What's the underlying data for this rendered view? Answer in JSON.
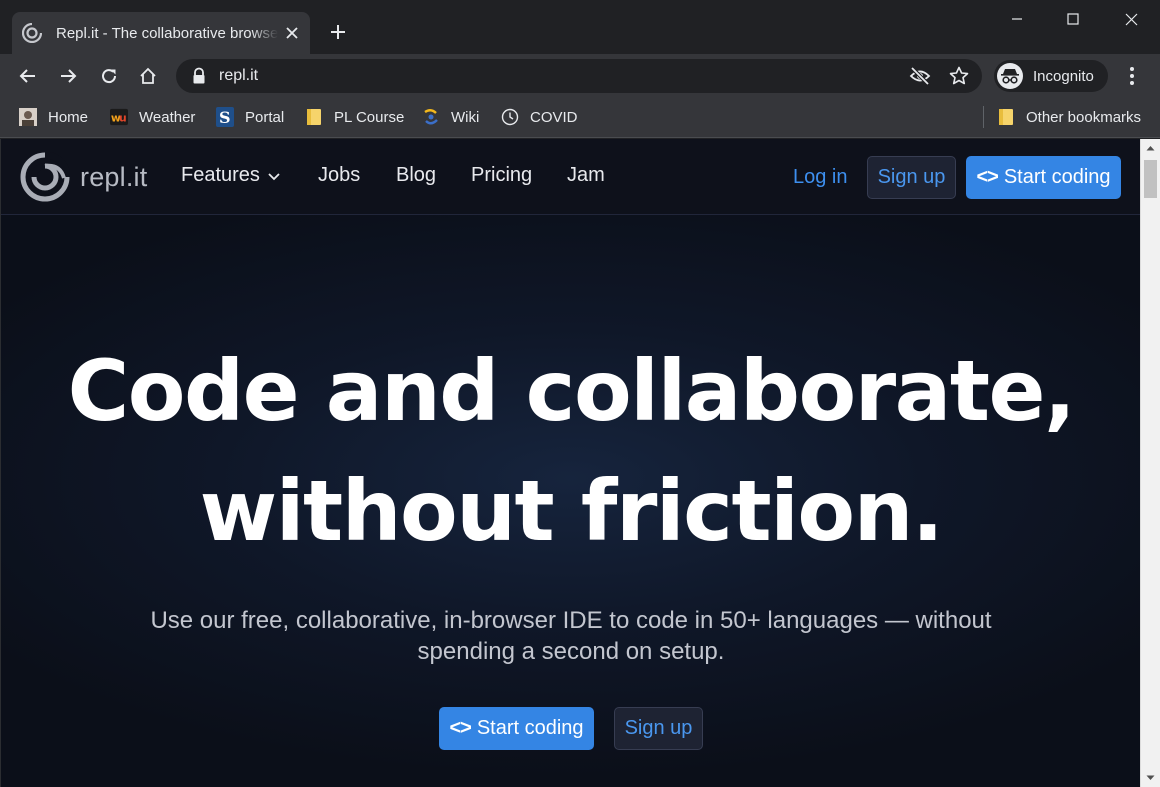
{
  "browser": {
    "tab_title": "Repl.it - The collaborative browser based IDE",
    "url": "repl.it",
    "profile_label": "Incognito",
    "bookmarks": [
      {
        "label": "Home",
        "icon": "avatar-icon"
      },
      {
        "label": "Weather",
        "icon": "weather-underground-icon"
      },
      {
        "label": "Portal",
        "icon": "portal-s-icon"
      },
      {
        "label": "PL Course",
        "icon": "folder-icon"
      },
      {
        "label": "Wiki",
        "icon": "wiki-icon"
      },
      {
        "label": "COVID",
        "icon": "covid-icon"
      }
    ],
    "other_bookmarks": "Other bookmarks"
  },
  "site": {
    "logo_text": "repl.it",
    "nav": {
      "features": "Features",
      "jobs": "Jobs",
      "blog": "Blog",
      "pricing": "Pricing",
      "jam": "Jam"
    },
    "login": "Log in",
    "signup": "Sign up",
    "start_coding": "Start coding",
    "code_glyph": "<>"
  },
  "hero": {
    "title_line1": "Code and collaborate,",
    "title_line2": "without friction.",
    "subtitle": "Use our free, collaborative, in-browser IDE to code in 50+ languages — without spending a second on setup.",
    "primary_cta": "Start coding",
    "secondary_cta": "Sign up"
  },
  "colors": {
    "accent": "#3485e4",
    "link": "#3d8fef",
    "page_bg": "#0d101a",
    "chrome_bg": "#202124",
    "toolbar_bg": "#35363a"
  }
}
